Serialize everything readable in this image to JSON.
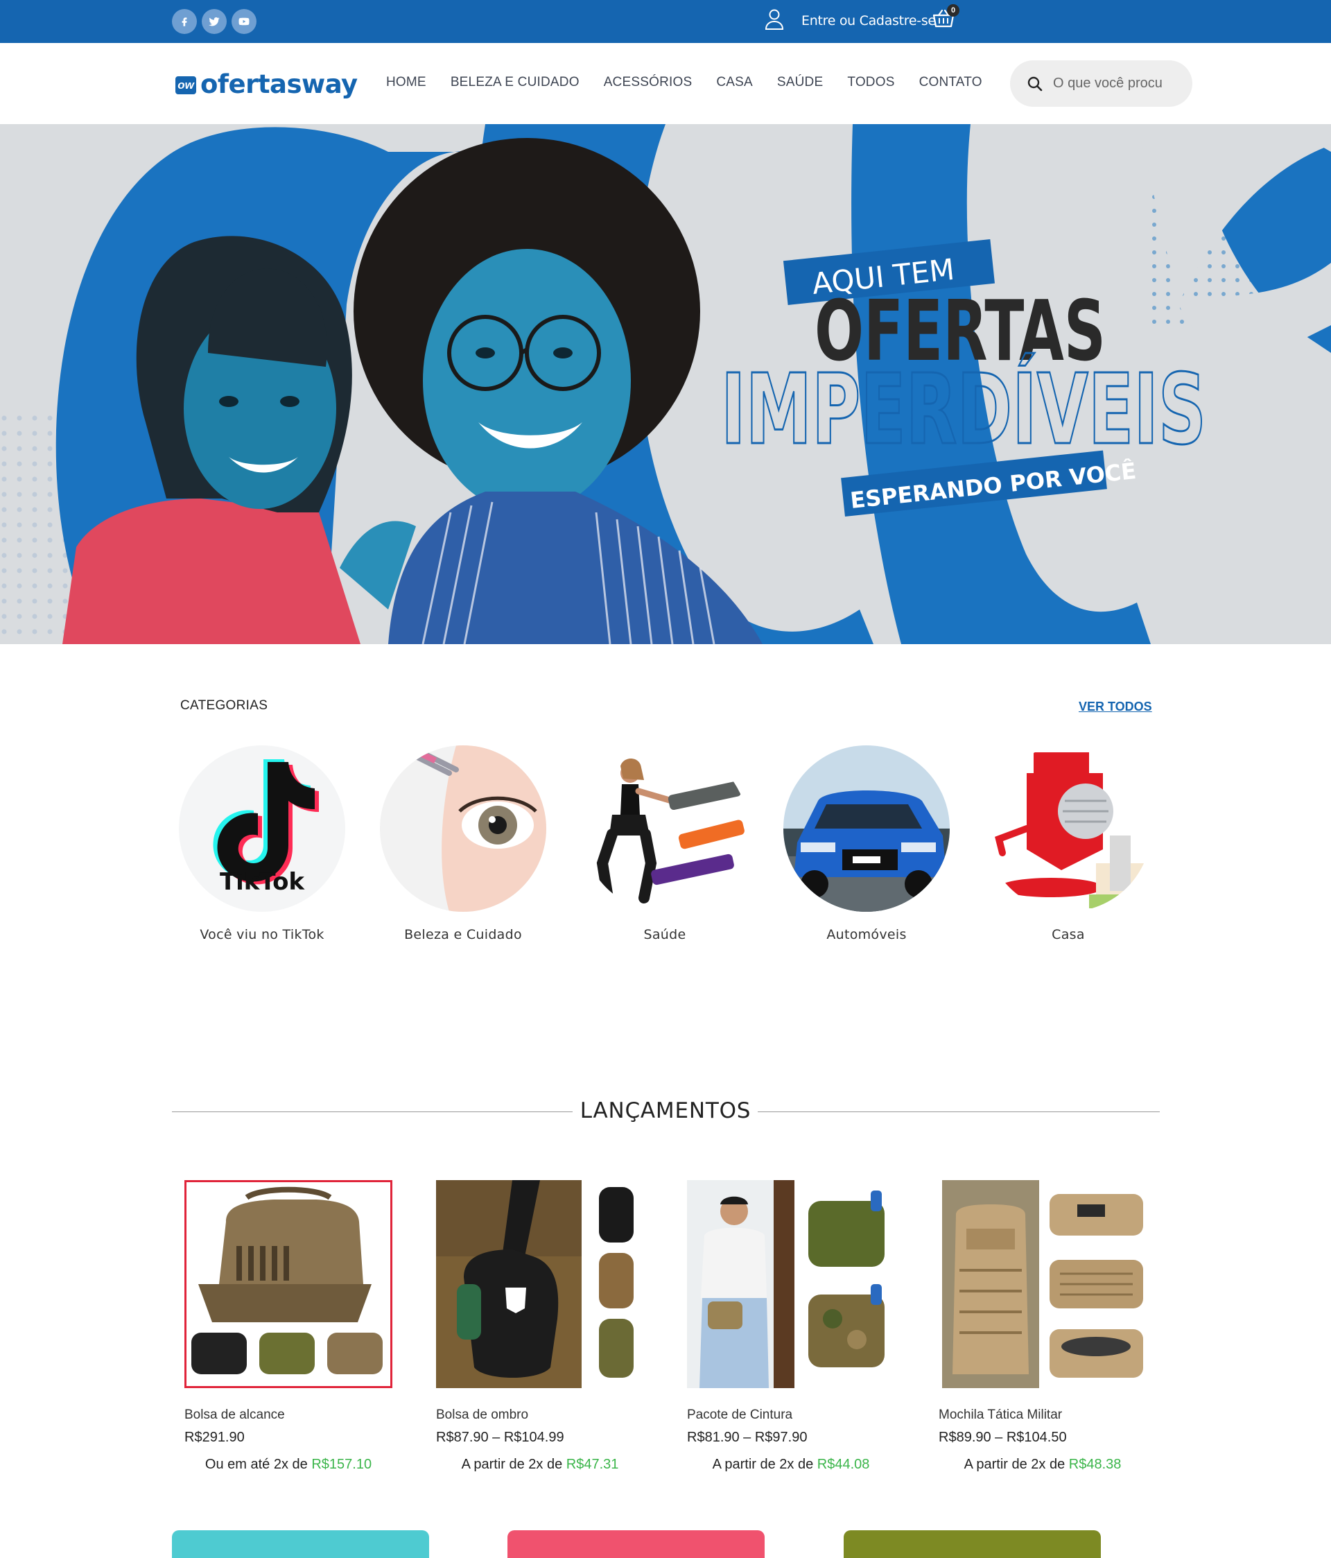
{
  "topbar": {
    "login_label": "Entre ou Cadastre-se",
    "cart_count": "0",
    "social": [
      "facebook-icon",
      "twitter-icon",
      "youtube-icon"
    ],
    "background": "#1565b0"
  },
  "nav": {
    "logo_mark": "ow",
    "logo_text": "ofertasway",
    "links": [
      "HOME",
      "BELEZA E CUIDADO",
      "ACESSÓRIOS",
      "CASA",
      "SAÚDE",
      "TODOS",
      "CONTATO"
    ],
    "search_placeholder": "O que você procu"
  },
  "hero": {
    "line1": "AQUI TEM",
    "line2": "OFERTAS",
    "line3": "IMPERDÍVEIS",
    "line4": "ESPERANDO POR VOCÊ"
  },
  "categories": {
    "title": "CATEGORIAS",
    "see_all": "VER TODOS",
    "items": [
      {
        "label": "Você viu no TikTok",
        "icon": "tiktok-logo"
      },
      {
        "label": "Beleza e Cuidado",
        "icon": "eye-tweezers"
      },
      {
        "label": "Saúde",
        "icon": "resistance-bands"
      },
      {
        "label": "Automóveis",
        "icon": "car"
      },
      {
        "label": "Casa",
        "icon": "grater"
      }
    ],
    "tiktok_wordmark": "TikTok"
  },
  "launches": {
    "title": "LANÇAMENTOS",
    "products": [
      {
        "name": "Bolsa de alcance",
        "price": "R$291.90",
        "installment_prefix": "Ou em até 2x de",
        "installment_value": "R$157.10"
      },
      {
        "name": "Bolsa de ombro",
        "price": "R$87.90 – R$104.99",
        "installment_prefix": "A partir de 2x de",
        "installment_value": "R$47.31"
      },
      {
        "name": "Pacote de Cintura",
        "price": "R$81.90 – R$97.90",
        "installment_prefix": "A partir de 2x de",
        "installment_value": "R$44.08"
      },
      {
        "name": "Mochila Tática Militar",
        "price": "R$89.90 – R$104.50",
        "installment_prefix": "A partir de 2x de",
        "installment_value": "R$48.38"
      }
    ]
  },
  "promo_colors": [
    "#4ecbd1",
    "#f0526e",
    "#7d8a23"
  ],
  "colors": {
    "brand": "#1565b0",
    "installment_highlight": "#3bb54a"
  }
}
